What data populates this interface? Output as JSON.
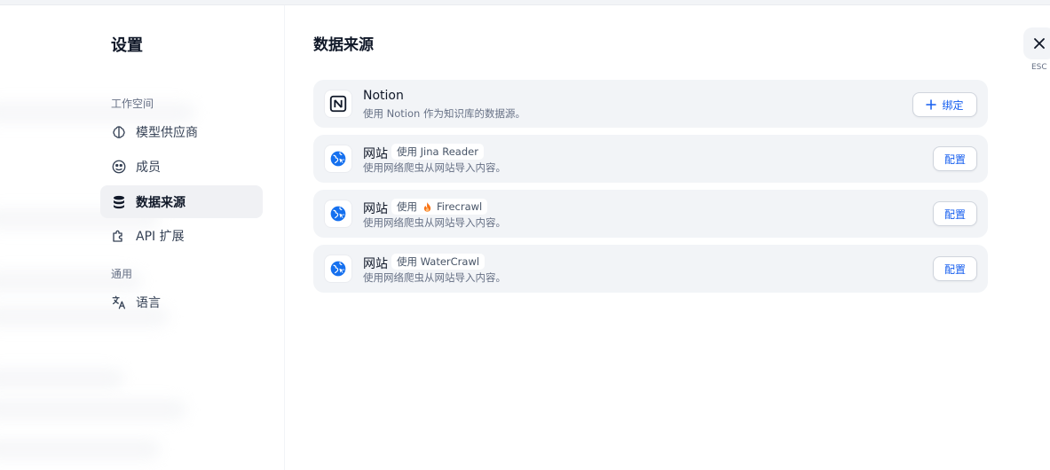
{
  "sidebar": {
    "title": "设置",
    "groups": {
      "workspace": "工作空间",
      "general": "通用"
    },
    "items": [
      {
        "label": "模型供应商",
        "icon": "brain-icon"
      },
      {
        "label": "成员",
        "icon": "members-icon"
      },
      {
        "label": "数据来源",
        "icon": "database-icon",
        "active": true
      },
      {
        "label": "API 扩展",
        "icon": "puzzle-icon"
      },
      {
        "label": "语言",
        "icon": "translate-icon"
      }
    ]
  },
  "main": {
    "title": "数据来源",
    "sources": [
      {
        "name": "Notion",
        "description": "使用 Notion 作为知识库的数据源。",
        "button": "绑定",
        "button_icon": "plus-icon",
        "logo": "notion-logo-icon"
      },
      {
        "name": "网站",
        "provider": "使用 Jina Reader",
        "description": "使用网络爬虫从网站导入内容。",
        "button": "配置",
        "logo": "website-globe-icon"
      },
      {
        "name": "网站",
        "provider_prefix": "使用",
        "provider_name": "Firecrawl",
        "provider_icon": "fire-icon",
        "description": "使用网络爬虫从网站导入内容。",
        "button": "配置",
        "logo": "website-globe-icon"
      },
      {
        "name": "网站",
        "provider": "使用 WaterCrawl",
        "description": "使用网络爬虫从网站导入内容。",
        "button": "配置",
        "logo": "website-globe-icon"
      }
    ]
  },
  "close": {
    "icon": "close-icon",
    "hint": "ESC"
  },
  "colors": {
    "accent": "#155eef",
    "globe": "#1570ef",
    "active_bg": "#f0f1f4",
    "card_bg": "#f2f4f7"
  }
}
